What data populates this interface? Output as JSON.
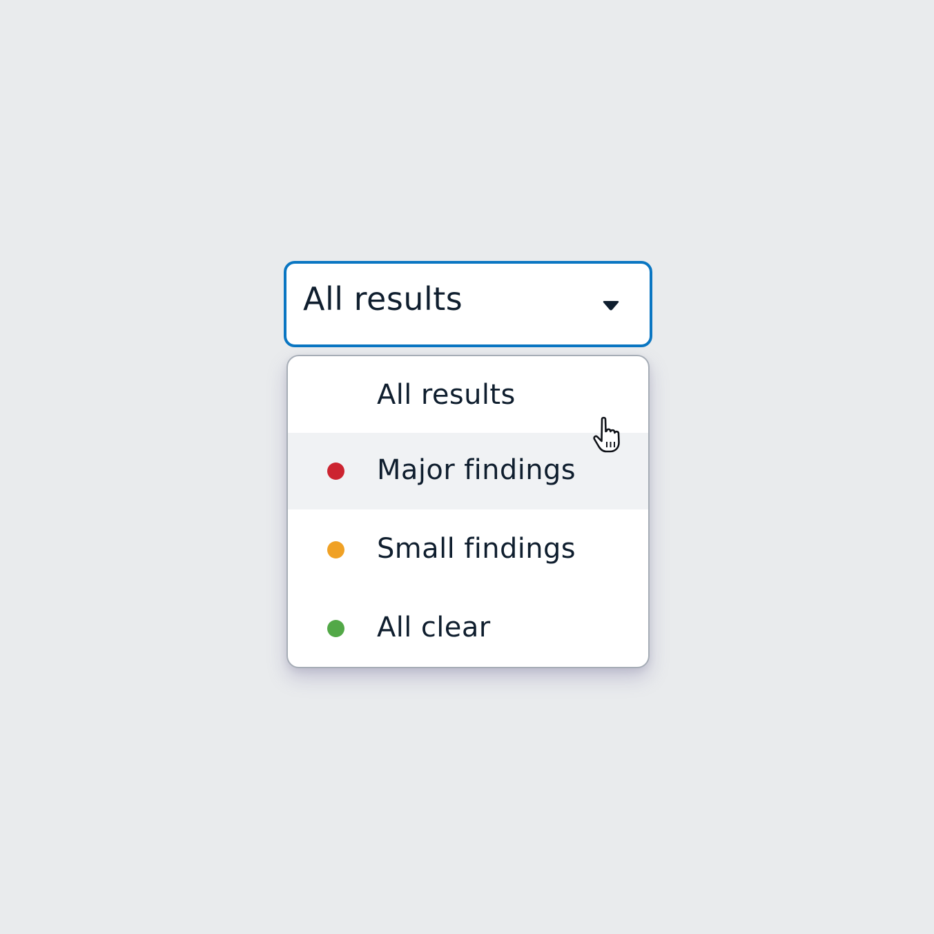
{
  "select": {
    "value": "All results",
    "caret_icon": "caret-down-icon",
    "border_color": "#0a76c2"
  },
  "menu": {
    "hovered_option": "Major findings",
    "options": [
      {
        "label": "All results",
        "dot_color": null
      },
      {
        "label": "Major findings",
        "dot_color": "#cc2430"
      },
      {
        "label": "Small findings",
        "dot_color": "#f0a125"
      },
      {
        "label": "All clear",
        "dot_color": "#52a847"
      }
    ]
  },
  "cursor": {
    "icon": "hand-pointer-icon"
  }
}
